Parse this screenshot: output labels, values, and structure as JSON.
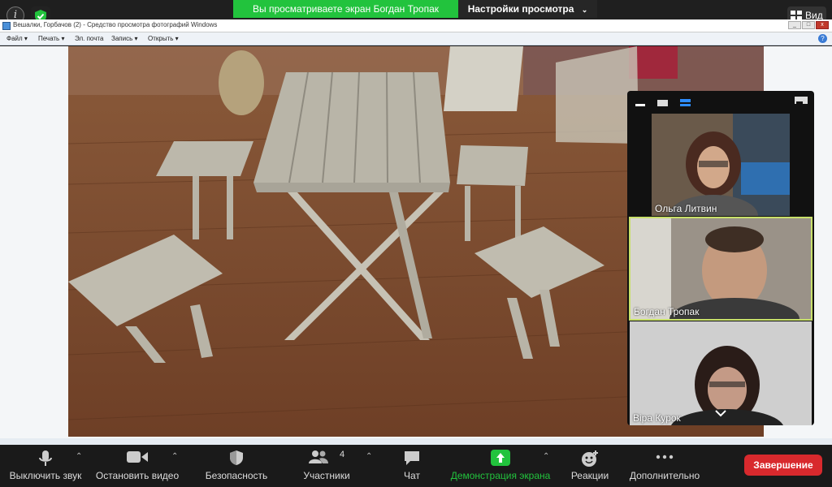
{
  "top_bar": {
    "banner_text": "Вы просматриваете экран Богдан Тропак",
    "view_options_label": "Настройки просмотра",
    "view_button_label": "Вид"
  },
  "shared_window": {
    "title": "Вешалки, Горбачов (2) - Средство просмотра фотографий Windows",
    "menu": [
      "Файл",
      "Печать",
      "Эл. почта",
      "Запись",
      "Открыть"
    ]
  },
  "gallery": {
    "participants": [
      {
        "name": "Ольга Литвин"
      },
      {
        "name": "Богдан Тропак"
      },
      {
        "name": "Віра Курок"
      }
    ]
  },
  "toolbar": {
    "mute": "Выключить звук",
    "stop_video": "Остановить видео",
    "security": "Безопасность",
    "participants": "Участники",
    "participants_count": "4",
    "chat": "Чат",
    "share_screen": "Демонстрация экрана",
    "reactions": "Реакции",
    "more": "Дополнительно",
    "end": "Завершение"
  },
  "colors": {
    "banner_green": "#22c33d",
    "share_green": "#22c33d",
    "end_red": "#d8292d",
    "active_speaker_border": "#c8e06a"
  }
}
